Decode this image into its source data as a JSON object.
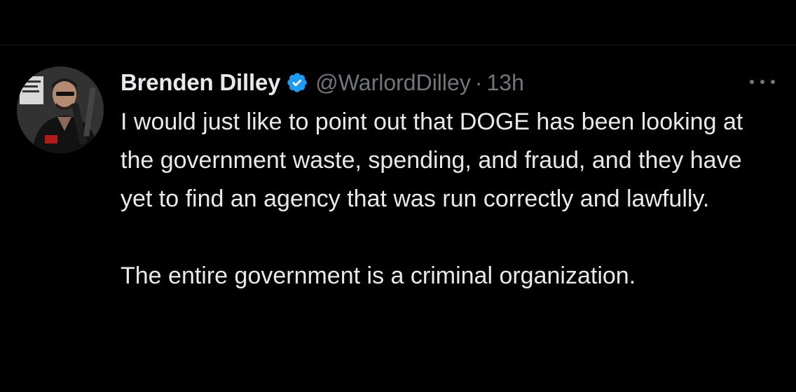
{
  "tweet": {
    "author": {
      "display_name": "Brenden Dilley",
      "handle": "@WarlordDilley",
      "verified": true,
      "avatar_icon": "user-avatar-photo"
    },
    "separator": "·",
    "time": "13h",
    "more_icon": "more-options-icon",
    "text": {
      "paragraph_1": "I would just like to point out that DOGE has been looking at the government waste, spending, and fraud, and they have yet to find an agency that was run correctly and lawfully.",
      "paragraph_2": "The entire government is a criminal organization."
    }
  },
  "colors": {
    "background": "#000000",
    "primary_text": "#e7e9ea",
    "secondary_text": "#71767b",
    "verified_badge": "#1d9bf0"
  }
}
